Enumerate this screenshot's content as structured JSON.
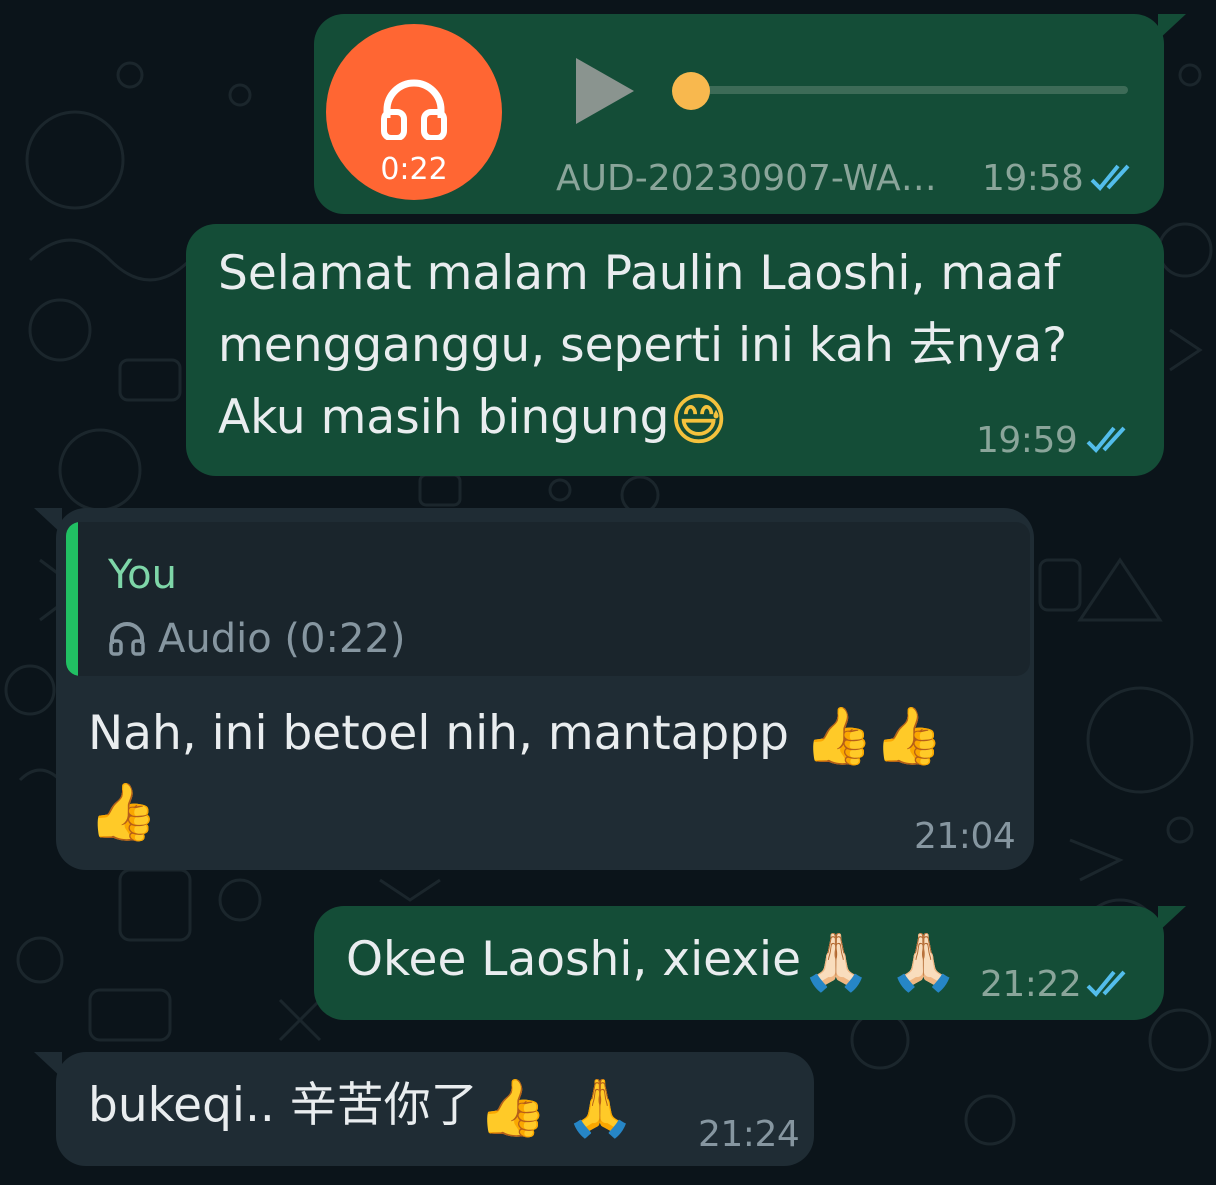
{
  "messages": [
    {
      "direction": "outgoing",
      "type": "audio",
      "duration": "0:22",
      "filename": "AUD-20230907-WA…",
      "time": "19:58",
      "status": "read"
    },
    {
      "direction": "outgoing",
      "type": "text",
      "text": "Selamat malam Paulin Laoshi, maaf\nmengganggu, seperti ini kah 去nya?\nAku masih bingung",
      "emoji": "😅",
      "time": "19:59",
      "status": "read"
    },
    {
      "direction": "incoming",
      "type": "reply",
      "quote": {
        "sender": "You",
        "text": "Audio (0:22)"
      },
      "text": "Nah, ini betoel nih, mantappp",
      "emoji_line1": "👍👍",
      "emoji_line2": "👍",
      "time": "21:04"
    },
    {
      "direction": "outgoing",
      "type": "text",
      "text": "Okee Laoshi, xiexie",
      "emoji": "🙏🏻 🙏🏻",
      "time": "21:22",
      "status": "read"
    },
    {
      "direction": "incoming",
      "type": "text",
      "text": "bukeqi.. 辛苦你了",
      "emoji": "👍 🙏",
      "time": "21:24"
    }
  ],
  "colors": {
    "background": "#0b141a",
    "outgoing_bubble": "#144d37",
    "incoming_bubble": "#1f2c34",
    "read_ticks": "#53bdeb",
    "audio_avatar": "#ff6633",
    "audio_knob": "#f8b84e",
    "quote_bar": "#21c063",
    "quote_sender": "#7ed6a8"
  },
  "icons": {
    "audio_avatar": "headphones-icon",
    "play": "play-icon",
    "read_status": "double-check-icon",
    "quote_audio": "headphones-icon"
  }
}
